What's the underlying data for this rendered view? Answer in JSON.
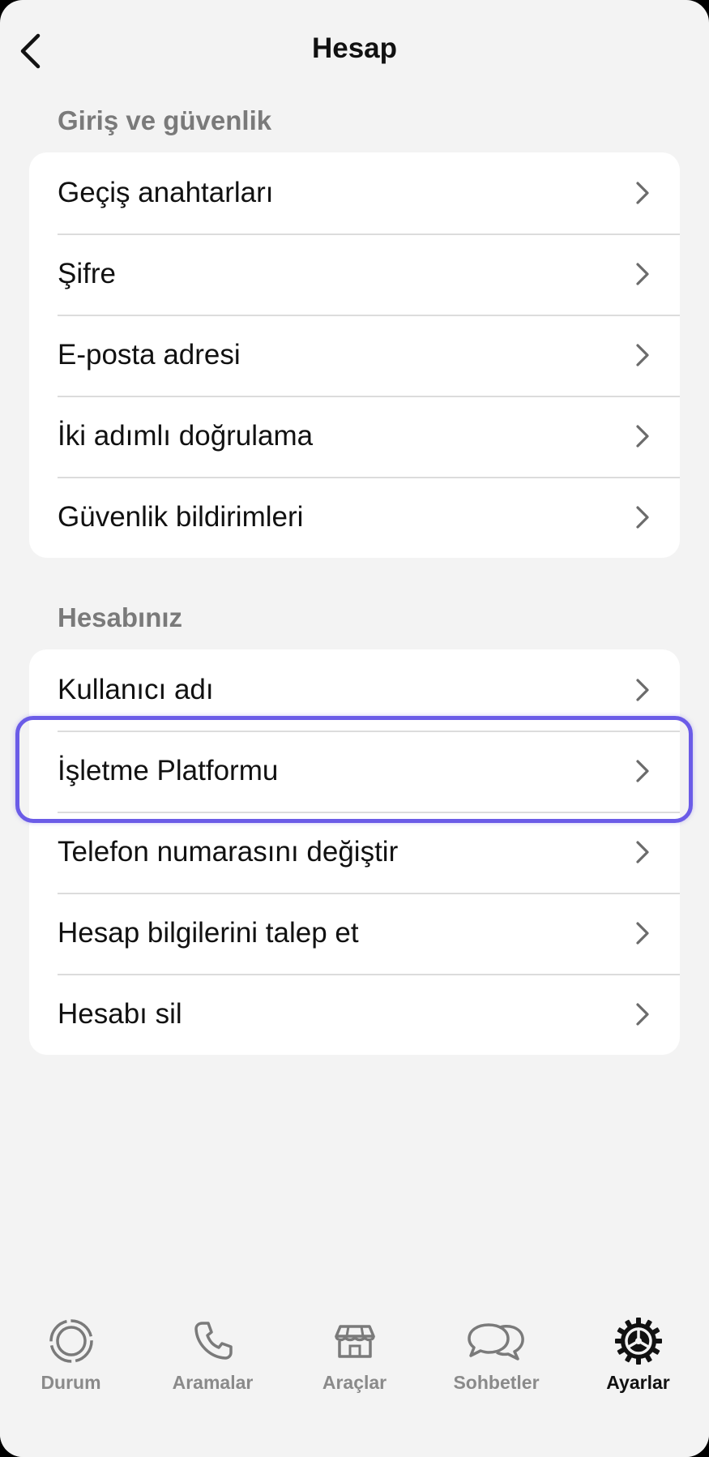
{
  "header": {
    "title": "Hesap"
  },
  "sections": [
    {
      "title": "Giriş ve güvenlik",
      "items": [
        {
          "label": "Geçiş anahtarları"
        },
        {
          "label": "Şifre"
        },
        {
          "label": "E-posta adresi"
        },
        {
          "label": "İki adımlı doğrulama"
        },
        {
          "label": "Güvenlik bildirimleri"
        }
      ]
    },
    {
      "title": "Hesabınız",
      "items": [
        {
          "label": "Kullanıcı adı"
        },
        {
          "label": "İşletme Platformu"
        },
        {
          "label": "Telefon numarasını değiştir"
        },
        {
          "label": "Hesap bilgilerini talep et"
        },
        {
          "label": "Hesabı sil"
        }
      ]
    }
  ],
  "highlighted_item": "İşletme Platformu",
  "tabs": [
    {
      "label": "Durum",
      "icon": "status-icon",
      "active": false
    },
    {
      "label": "Aramalar",
      "icon": "phone-icon",
      "active": false
    },
    {
      "label": "Araçlar",
      "icon": "store-icon",
      "active": false
    },
    {
      "label": "Sohbetler",
      "icon": "chat-bubbles-icon",
      "active": false
    },
    {
      "label": "Ayarlar",
      "icon": "settings-gear-icon",
      "active": true
    }
  ],
  "colors": {
    "highlight": "#6b5ce7",
    "background": "#f3f3f3",
    "card": "#ffffff"
  }
}
